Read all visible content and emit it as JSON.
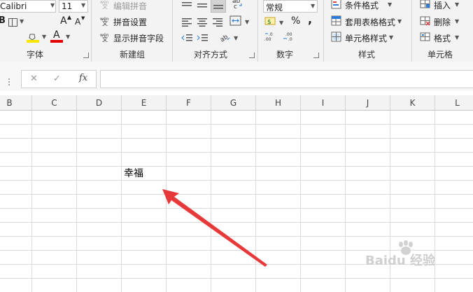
{
  "font_group": {
    "font_name": "Calibri",
    "font_size": "11",
    "bold_label": "B",
    "grow_label": "A",
    "shrink_label": "A",
    "font_color_label": "A",
    "label": "字体"
  },
  "new_group": {
    "edit_pinyin_label": "编辑拼音",
    "pinyin_settings_label": "拼音设置",
    "show_pinyin_field_label": "显示拼音字段",
    "label": "新建组"
  },
  "align_group": {
    "label": "对齐方式"
  },
  "number_group": {
    "format_value": "常规",
    "percent_label": "%",
    "comma_label": ",",
    "label": "数字"
  },
  "style_group": {
    "conditional_format_label": "条件格式",
    "table_format_label": "套用表格格式",
    "cell_style_label": "单元格样式",
    "label": "样式"
  },
  "cells_group": {
    "insert_label": "插入",
    "delete_label": "删除",
    "format_label": "格式",
    "label": "单元格"
  },
  "formula_bar": {
    "cancel_symbol": "✕",
    "confirm_symbol": "✓",
    "fx_label": "fx"
  },
  "columns": [
    "B",
    "C",
    "D",
    "E",
    "F",
    "G",
    "H",
    "I",
    "J",
    "K",
    "L"
  ],
  "cells": {
    "e_text": "幸福"
  },
  "watermark": {
    "text": "Baidu 经验"
  },
  "colors": {
    "arrow": "#e8393a",
    "grid": "#dadada",
    "highlight_yellow": "#ffe600",
    "font_red": "#e00000"
  }
}
